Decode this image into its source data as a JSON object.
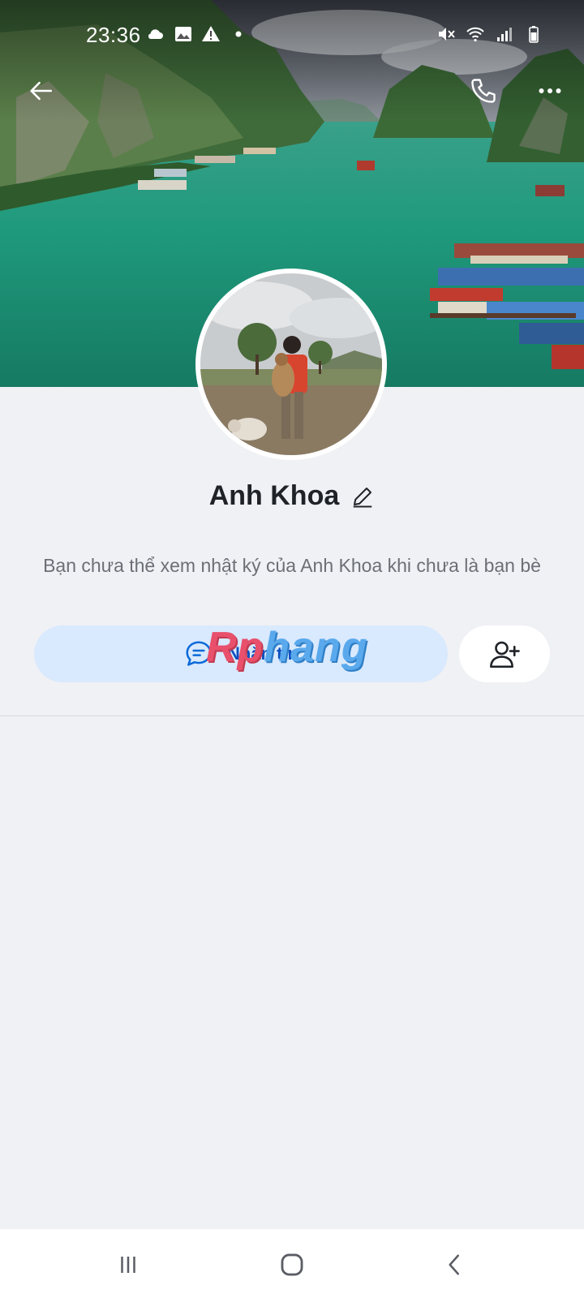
{
  "status_bar": {
    "time": "23:36",
    "left_icons": [
      "cloud-icon",
      "image-icon",
      "warning-icon",
      "dot-icon"
    ],
    "right_icons": [
      "mute-icon",
      "wifi-icon",
      "signal-icon",
      "battery-icon"
    ]
  },
  "top_bar": {
    "back_icon": "back-arrow-icon",
    "call_icon": "phone-icon",
    "more_icon": "more-icon"
  },
  "profile": {
    "name": "Anh Khoa",
    "edit_icon": "pencil-icon",
    "notice": "Bạn chưa thể xem nhật ký của Anh Khoa khi chưa là bạn bè"
  },
  "actions": {
    "message_label": "Nhắn tin",
    "message_icon": "chat-bubble-icon",
    "add_friend_icon": "add-friend-icon"
  },
  "watermark": {
    "part1": "Rp",
    "part2": "hang"
  },
  "nav_bar": {
    "icons": [
      "recent-apps-icon",
      "home-icon",
      "nav-back-icon"
    ]
  },
  "colors": {
    "background": "#f0f1f5",
    "message_button_bg": "#d9e9fe",
    "message_button_text": "#0b4fbf",
    "water": "#1f9a7c"
  }
}
